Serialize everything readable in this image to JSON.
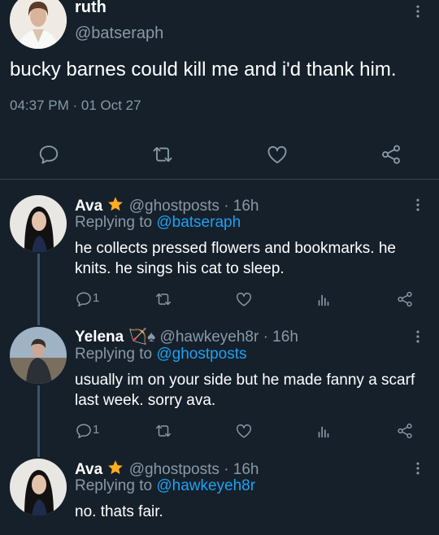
{
  "main_tweet": {
    "author_name": "ruth",
    "author_handle": "@batseraph",
    "text": "bucky barnes could kill me and i'd thank him.",
    "timestamp": "04:37 PM · 01 Oct 27"
  },
  "replies": [
    {
      "name": "Ava",
      "badge": "★",
      "handle": "@ghostposts",
      "age": "· 16h",
      "replying_prefix": "Replying to",
      "replying_to": "@batseraph",
      "text": "he collects pressed flowers and bookmarks. he knits. he sings his cat to sleep.",
      "reply_count": "1"
    },
    {
      "name": "Yelena",
      "badge": "🏹♠",
      "handle": "@hawkeyeh8r",
      "age": "· 16h",
      "replying_prefix": "Replying to",
      "replying_to": "@ghostposts",
      "text": "usually im on your side but he made fanny a scarf last week. sorry ava.",
      "reply_count": "1"
    },
    {
      "name": "Ava",
      "badge": "★",
      "handle": "@ghostposts",
      "age": "· 16h",
      "replying_prefix": "Replying to",
      "replying_to": "@hawkeyeh8r",
      "text": "no. thats fair."
    }
  ],
  "colors": {
    "background": "#15202b",
    "muted": "#8899a6",
    "link": "#1da1f2",
    "star": "#ffad1f",
    "divider": "#38444d"
  },
  "icons": [
    "reply-icon",
    "retweet-icon",
    "like-icon",
    "share-icon",
    "analytics-icon",
    "more-icon",
    "star-icon"
  ]
}
